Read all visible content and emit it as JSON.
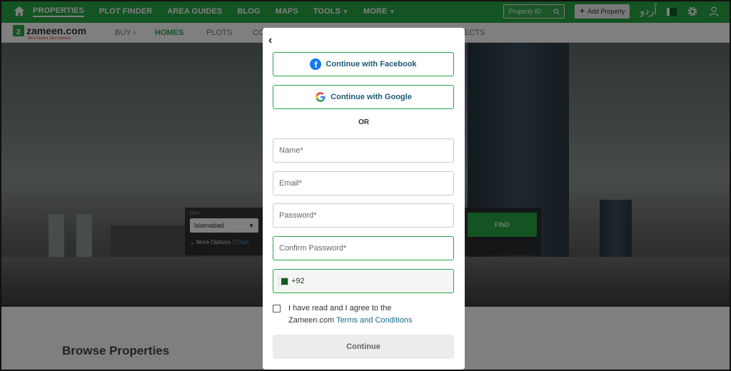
{
  "topnav": {
    "items": [
      "PROPERTIES",
      "PLOT FINDER",
      "AREA GUIDES",
      "BLOG",
      "MAPS",
      "TOOLS",
      "MORE"
    ],
    "property_id_placeholder": "Property ID",
    "add_property": "Add Property",
    "urdu": "اُردو"
  },
  "subnav": {
    "logo": "zameen.com",
    "tagline": "Meri Pasand, Meri Zameen",
    "items": [
      "BUY",
      "HOMES",
      "PLOTS",
      "CO",
      "ECTS"
    ]
  },
  "hero": {
    "city_label": "CITY",
    "city_value": "Islamabad",
    "more_options": "More Options",
    "change": "Chan",
    "find": "FIND"
  },
  "page": {
    "browse_title": "Browse Properties"
  },
  "modal": {
    "facebook": "Continue with Facebook",
    "google": "Continue with Google",
    "or": "OR",
    "name_placeholder": "Name*",
    "email_placeholder": "Email*",
    "password_placeholder": "Password*",
    "confirm_placeholder": "Confirm Password*",
    "phone_prefix": "+92",
    "agree_line1": "I have read and I agree to the",
    "agree_line2": "Zameen.com",
    "terms": "Terms and Conditions",
    "continue": "Continue"
  },
  "colors": {
    "brand": "#28a745",
    "link": "#1a6a8a"
  }
}
